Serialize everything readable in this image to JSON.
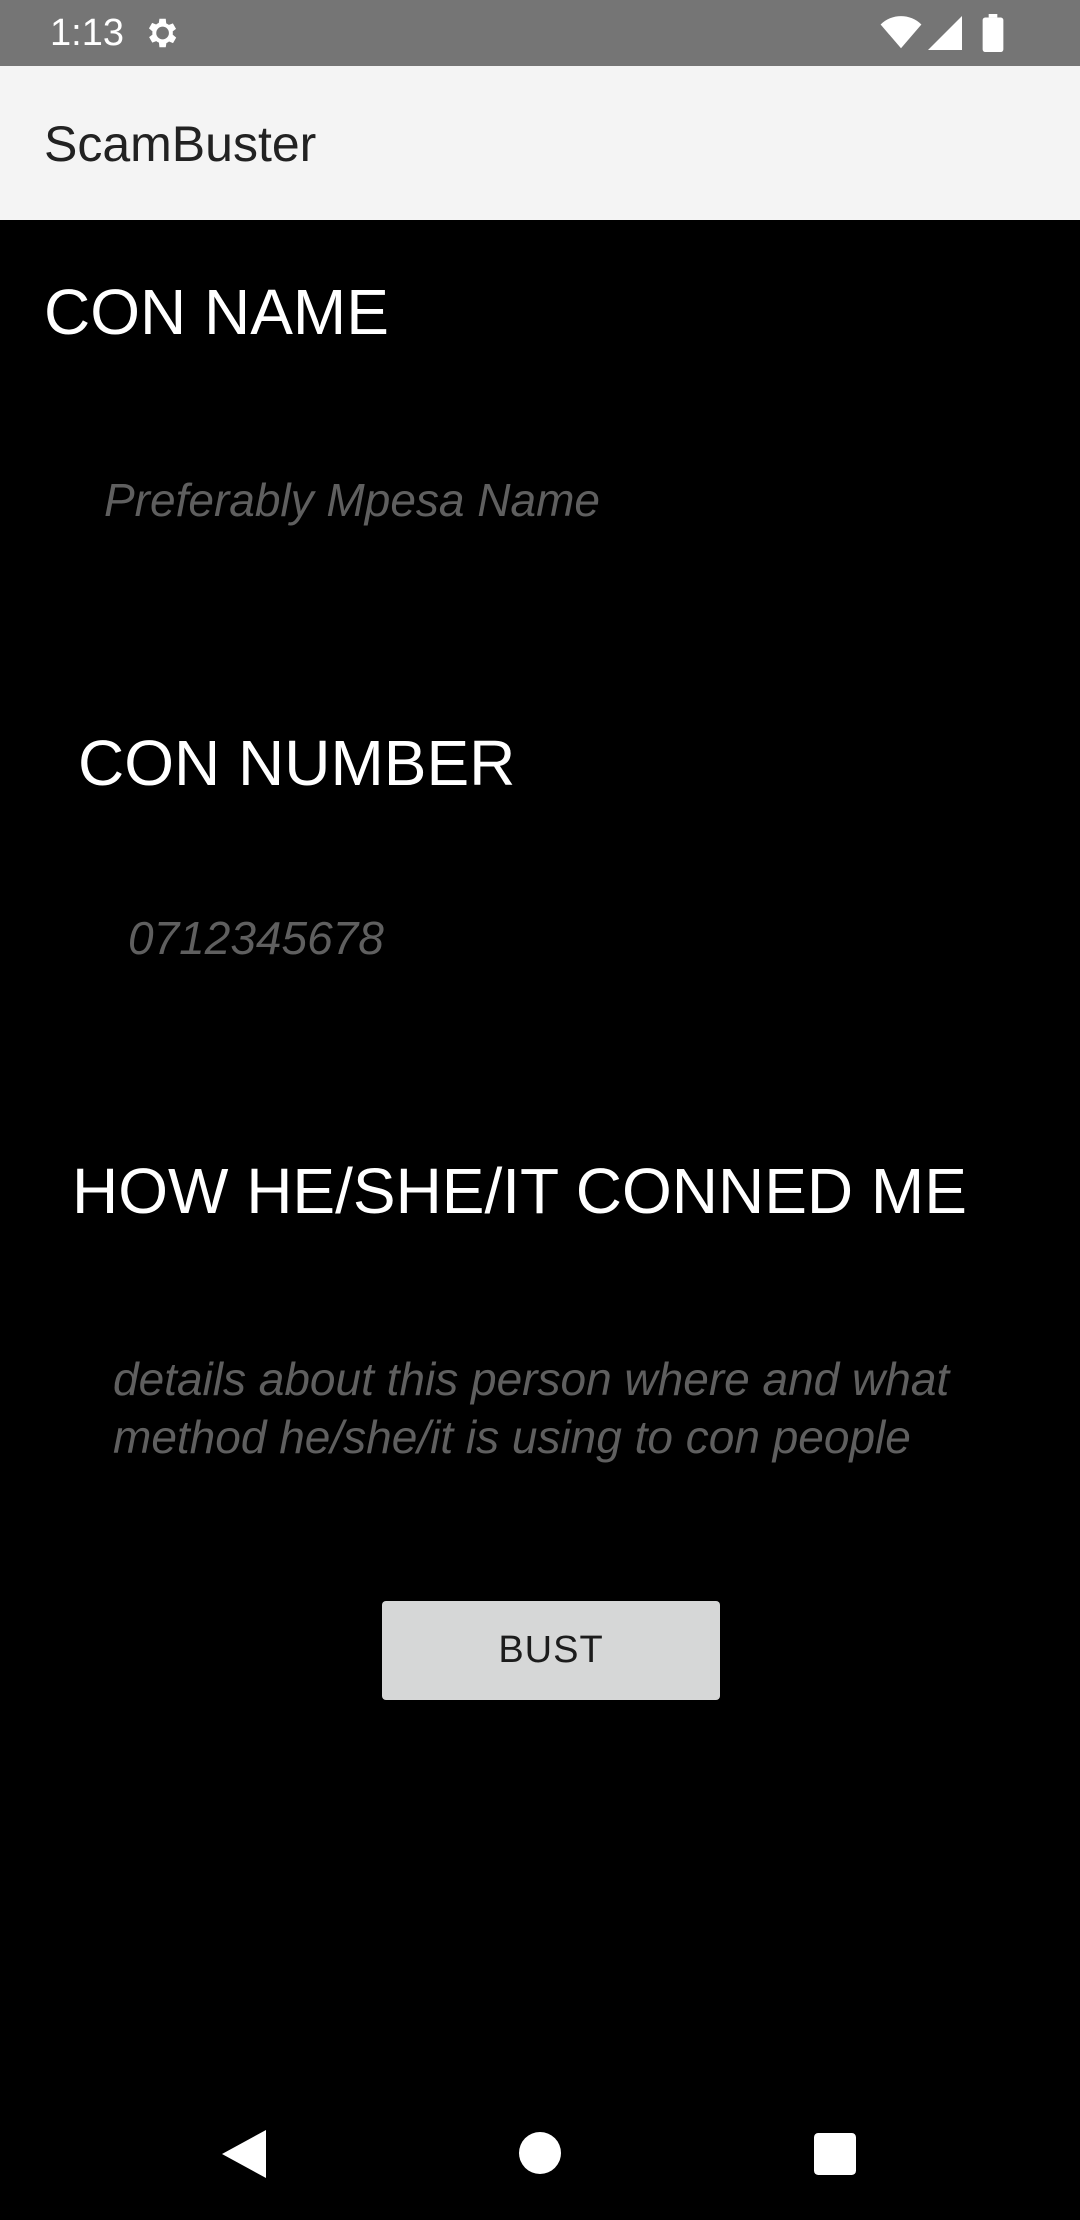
{
  "status_bar": {
    "time": "1:13",
    "icons": [
      "settings-gear-icon",
      "wifi-icon",
      "cell-signal-icon",
      "battery-icon"
    ]
  },
  "app_bar": {
    "title": "ScamBuster"
  },
  "form": {
    "con_name_label": "CON NAME",
    "con_name_placeholder": "Preferably Mpesa Name",
    "con_number_label": "CON NUMBER",
    "con_number_placeholder": "0712345678",
    "method_label": "HOW HE/SHE/IT CONNED ME",
    "method_placeholder": "details about this person where and what method he/she/it is using to con people",
    "submit_label": "BUST"
  },
  "nav_bar": {
    "icons": [
      "back-icon",
      "home-icon",
      "recents-icon"
    ]
  },
  "colors": {
    "status_bar": "#757575",
    "app_bar": "#f4f4f4",
    "background": "#000000",
    "label_text": "#ffffff",
    "hint_text": "#5f5f5f",
    "button": "#d6d7d7"
  }
}
